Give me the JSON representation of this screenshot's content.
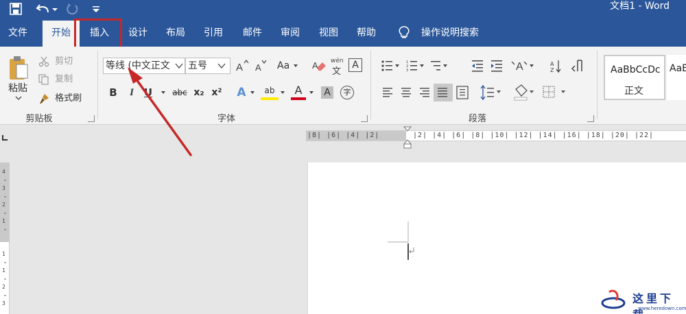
{
  "title": "文档1  -  Word",
  "tabs": [
    "文件",
    "开始",
    "插入",
    "设计",
    "布局",
    "引用",
    "邮件",
    "审阅",
    "视图",
    "帮助"
  ],
  "active_tab": "开始",
  "help_search": "操作说明搜索",
  "clipboard": {
    "paste": "粘贴",
    "cut": "剪切",
    "copy": "复制",
    "format_painter": "格式刷",
    "group_label": "剪贴板"
  },
  "font": {
    "font_name": "等线 (中文正文",
    "font_size": "五号",
    "group_label": "字体",
    "case_label": "Aa",
    "bold": "B",
    "italic": "I",
    "underline": "U",
    "strike": "abc",
    "subscript": "x₂",
    "superscript": "x²",
    "phonetic_guide": "wén",
    "phonetic_char": "文",
    "char_border": "A",
    "text_effects": "A",
    "highlight": "ab",
    "font_color": "A",
    "char_shading": "A",
    "enclose": "字"
  },
  "paragraph": {
    "group_label": "段落"
  },
  "styles": {
    "sample": "AaBbCcDc",
    "style_name": "正文",
    "sample2": "AaBl"
  },
  "ruler": {
    "h_left": "|8|  |6|  |4|  |2|",
    "h_right": "|2|  |4|  |6|  |8|  |10|  |12|  |14|  |16|  |18|  |20|  |22|"
  },
  "watermark": {
    "text": "这里下载",
    "url": "www.heredown.com"
  },
  "colors": {
    "brand": "#2b579a",
    "ribbon": "#f3f3f3",
    "highlight_box": "#c62828"
  }
}
